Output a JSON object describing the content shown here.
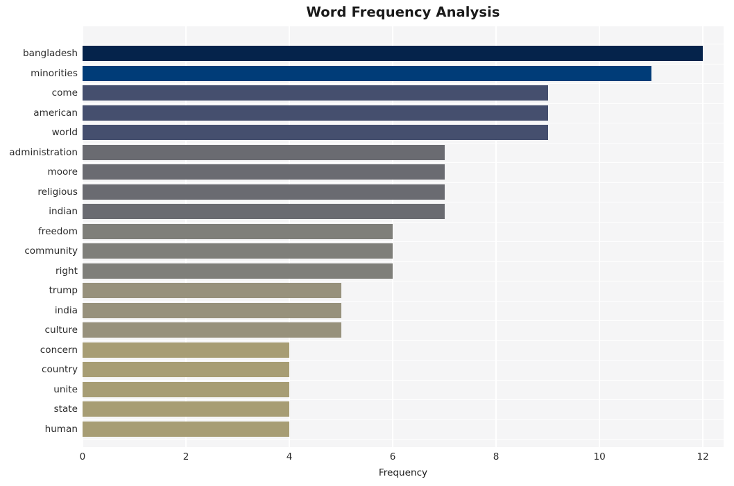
{
  "chart_data": {
    "type": "bar",
    "orientation": "horizontal",
    "title": "Word Frequency Analysis",
    "xlabel": "Frequency",
    "ylabel": "",
    "xlim": [
      0,
      12.4
    ],
    "xticks": [
      0,
      2,
      4,
      6,
      8,
      10,
      12
    ],
    "xtick_labels": [
      "0",
      "2",
      "4",
      "6",
      "8",
      "10",
      "12"
    ],
    "grid": true,
    "legend": null,
    "categories": [
      "bangladesh",
      "minorities",
      "come",
      "american",
      "world",
      "administration",
      "moore",
      "religious",
      "indian",
      "freedom",
      "community",
      "right",
      "trump",
      "india",
      "culture",
      "concern",
      "country",
      "unite",
      "state",
      "human"
    ],
    "values": [
      12,
      11,
      9,
      9,
      9,
      7,
      7,
      7,
      7,
      6,
      6,
      6,
      5,
      5,
      5,
      4,
      4,
      4,
      4,
      4
    ],
    "bar_colors": [
      "#05234b",
      "#003c78",
      "#454f6e",
      "#454f6e",
      "#454f6e",
      "#6a6b71",
      "#6a6b71",
      "#6a6b71",
      "#6a6b71",
      "#7f7f7a",
      "#7f7f7a",
      "#7f7f7a",
      "#97917c",
      "#97917c",
      "#97917c",
      "#a79d74",
      "#a79d74",
      "#a79d74",
      "#a79d74",
      "#a79d74"
    ],
    "plot_background": "#f5f5f6",
    "figure_background": "#ffffff",
    "grid_color": "#ffffff"
  }
}
